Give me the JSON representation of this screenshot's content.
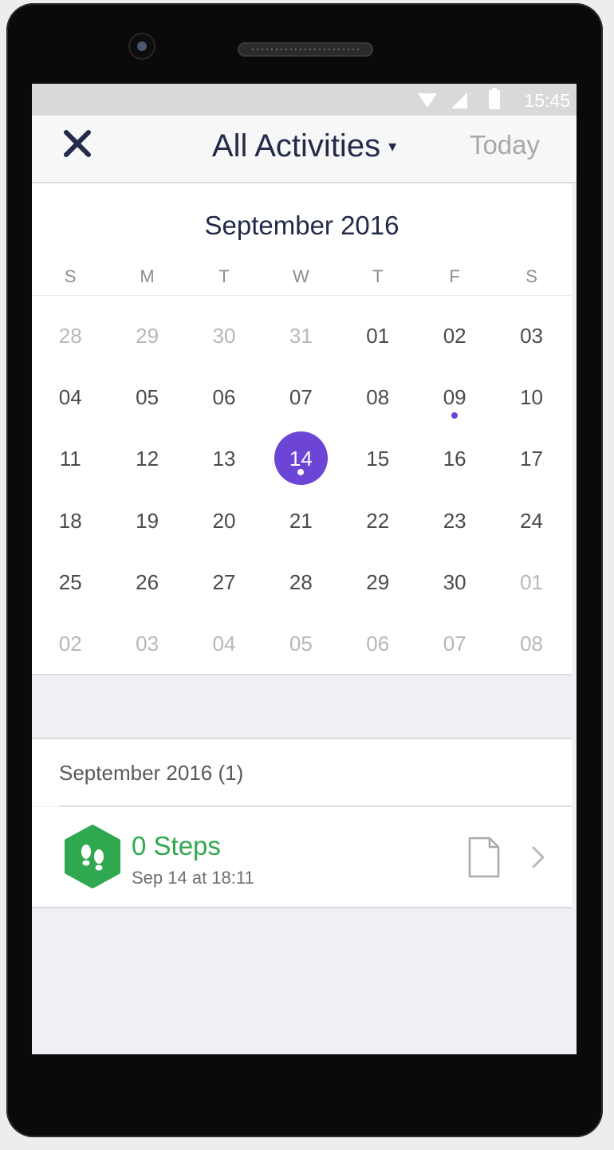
{
  "status_bar": {
    "time": "15:45"
  },
  "header": {
    "title": "All Activities",
    "caret": "▾",
    "today_label": "Today"
  },
  "calendar": {
    "month_title": "September 2016",
    "weekdays": [
      "S",
      "M",
      "T",
      "W",
      "T",
      "F",
      "S"
    ],
    "weeks": [
      [
        {
          "d": "28",
          "faded": true
        },
        {
          "d": "29",
          "faded": true
        },
        {
          "d": "30",
          "faded": true
        },
        {
          "d": "31",
          "faded": true
        },
        {
          "d": "01"
        },
        {
          "d": "02"
        },
        {
          "d": "03"
        }
      ],
      [
        {
          "d": "04"
        },
        {
          "d": "05"
        },
        {
          "d": "06"
        },
        {
          "d": "07"
        },
        {
          "d": "08"
        },
        {
          "d": "09",
          "dot": true
        },
        {
          "d": "10"
        }
      ],
      [
        {
          "d": "11"
        },
        {
          "d": "12"
        },
        {
          "d": "13"
        },
        {
          "d": "14",
          "selected": true,
          "dot": true
        },
        {
          "d": "15"
        },
        {
          "d": "16"
        },
        {
          "d": "17"
        }
      ],
      [
        {
          "d": "18"
        },
        {
          "d": "19"
        },
        {
          "d": "20"
        },
        {
          "d": "21"
        },
        {
          "d": "22"
        },
        {
          "d": "23"
        },
        {
          "d": "24"
        }
      ],
      [
        {
          "d": "25"
        },
        {
          "d": "26"
        },
        {
          "d": "27"
        },
        {
          "d": "28"
        },
        {
          "d": "29"
        },
        {
          "d": "30"
        },
        {
          "d": "01",
          "faded": true
        }
      ],
      [
        {
          "d": "02",
          "faded": true
        },
        {
          "d": "03",
          "faded": true
        },
        {
          "d": "04",
          "faded": true
        },
        {
          "d": "05",
          "faded": true
        },
        {
          "d": "06",
          "faded": true
        },
        {
          "d": "07",
          "faded": true
        },
        {
          "d": "08",
          "faded": true
        }
      ]
    ],
    "accent_color": "#6c45d6"
  },
  "activities": {
    "section_title": "September 2016 (1)",
    "items": [
      {
        "title": "0 Steps",
        "subtitle": "Sep 14 at 18:11",
        "icon": "footsteps-icon",
        "color": "#2fa84f"
      }
    ]
  }
}
